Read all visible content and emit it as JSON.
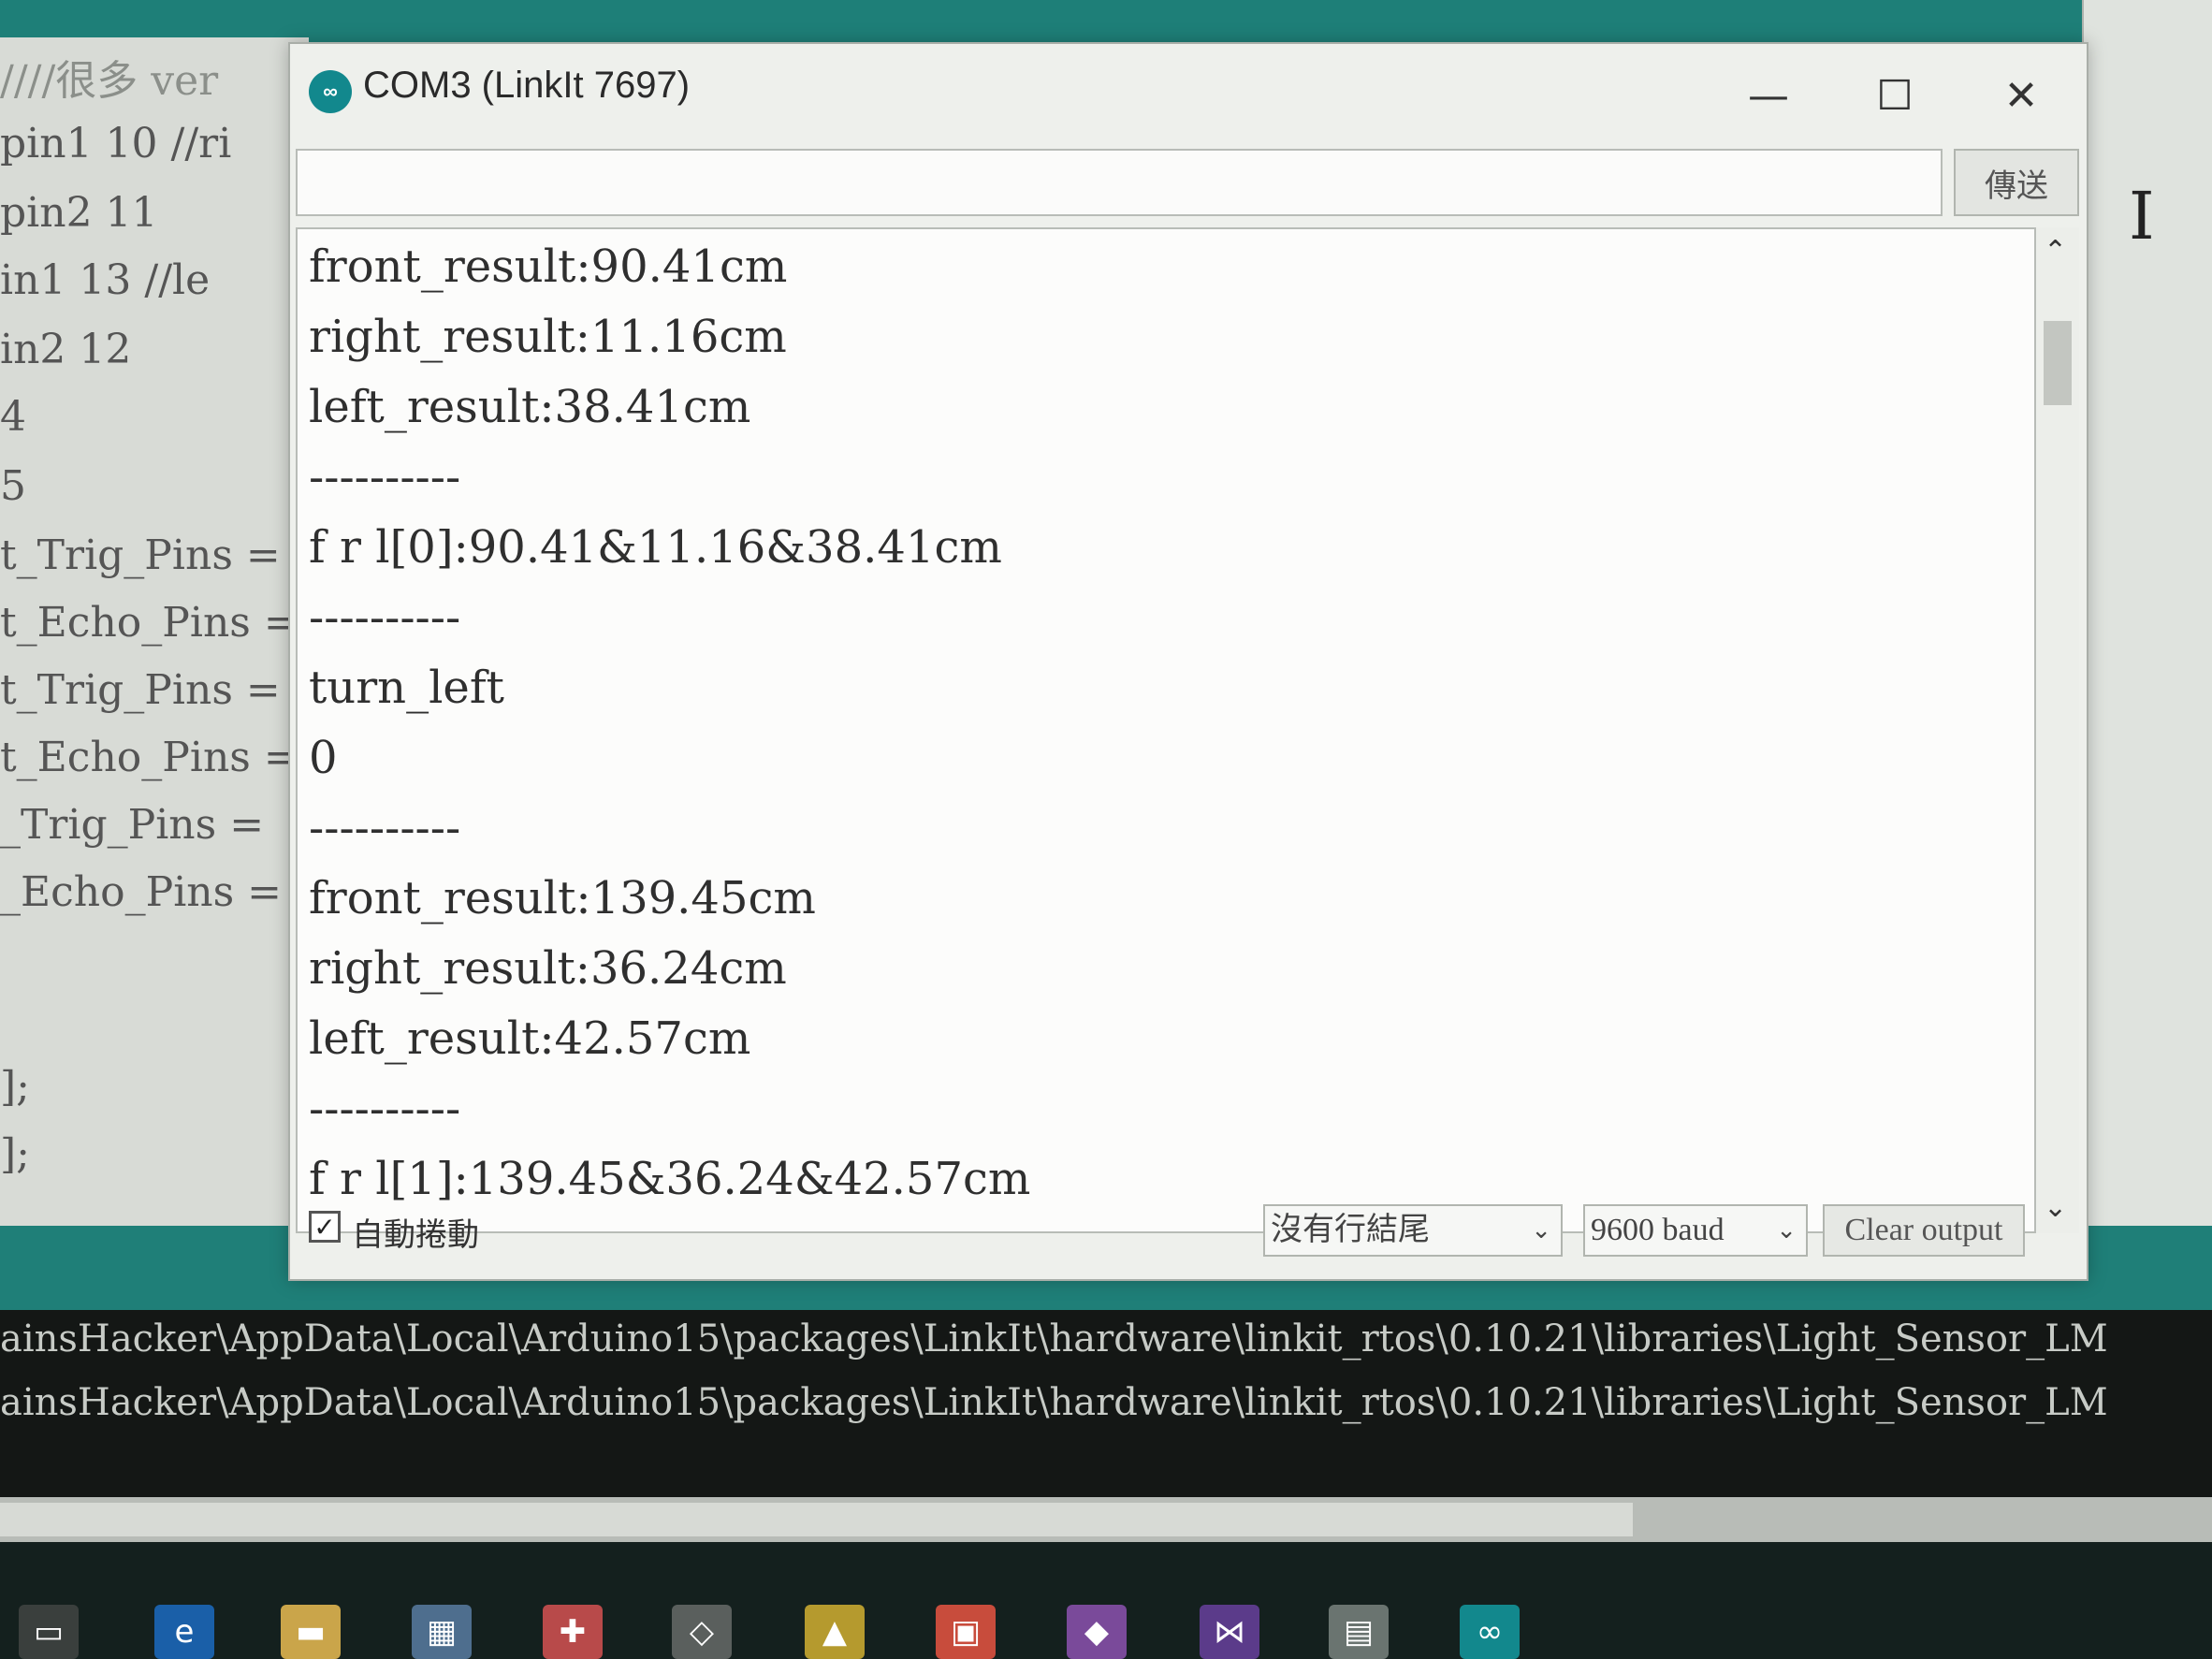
{
  "window": {
    "title": "COM3 (LinkIt 7697)",
    "icon_label": "∞",
    "minimize_glyph": "—",
    "maximize_glyph": "☐",
    "close_glyph": "✕"
  },
  "send": {
    "input_value": "",
    "button_label": "傳送"
  },
  "output_lines": [
    "front_result:90.41cm",
    "right_result:11.16cm",
    "left_result:38.41cm",
    "----------",
    "f r l[0]:90.41&11.16&38.41cm",
    "----------",
    "turn_left",
    "0",
    "----------",
    "front_result:139.45cm",
    "right_result:36.24cm",
    "left_result:42.57cm",
    "----------",
    "f r l[1]:139.45&36.24&42.57cm"
  ],
  "footer": {
    "autoscroll_label": "自動捲動",
    "autoscroll_checked": true,
    "line_ending": "沒有行結尾",
    "baud_rate": "9600 baud",
    "clear_label": "Clear output"
  },
  "ide_code_lines": [
    "////很多 ver",
    "pin1 10 //ri",
    "pin2 11",
    "in1 13 //le",
    "in2 12",
    "4",
    "5",
    "t_Trig_Pins =",
    "t_Echo_Pins =",
    "t_Trig_Pins =",
    "t_Echo_Pins =",
    "_Trig_Pins =",
    "_Echo_Pins =",
    "];",
    "];"
  ],
  "console_lines": [
    "ainsHacker\\AppData\\Local\\Arduino15\\packages\\LinkIt\\hardware\\linkit_rtos\\0.10.21\\libraries\\Light_Sensor_LM",
    "ainsHacker\\AppData\\Local\\Arduino15\\packages\\LinkIt\\hardware\\linkit_rtos\\0.10.21\\libraries\\Light_Sensor_LM"
  ],
  "taskbar": {
    "icons": [
      "task-view-icon",
      "edge-icon",
      "file-explorer-icon",
      "store-icon",
      "gift-icon",
      "box-icon",
      "tool-icon",
      "app-icon",
      "photo-icon",
      "visual-studio-icon",
      "image-icon",
      "arduino-icon"
    ]
  },
  "colors": {
    "accent": "#1f7f78",
    "arduino_icon": "#12888d"
  }
}
